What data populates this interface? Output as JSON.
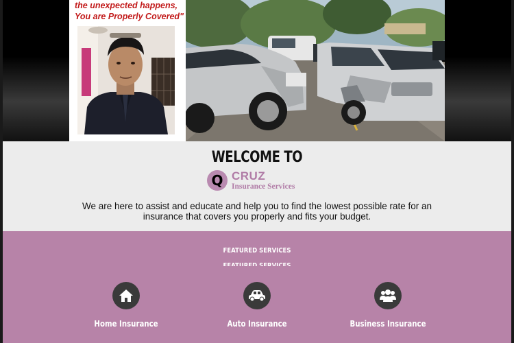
{
  "hero": {
    "quote_line1": "the unexpected happens,",
    "quote_line2": "You are Properly Covered\""
  },
  "welcome": {
    "title": "WELCOME TO",
    "logo": {
      "letter": "Q",
      "name": "CRUZ",
      "subtitle": "Insurance Services"
    },
    "description": "We are here to assist and educate and help you to find the lowest possible rate for an insurance that covers you properly and fits your budget."
  },
  "services": {
    "heading": "FEATURED SERVICES",
    "subheading": "FEATURED SERVICES",
    "items": [
      {
        "icon": "home-icon",
        "label": "Home Insurance"
      },
      {
        "icon": "car-icon",
        "label": "Auto Insurance"
      },
      {
        "icon": "users-icon",
        "label": "Business Insurance"
      }
    ]
  },
  "colors": {
    "brand_purple": "#b783a8",
    "quote_red": "#c21a1a",
    "icon_dark": "#3a3a3a"
  }
}
